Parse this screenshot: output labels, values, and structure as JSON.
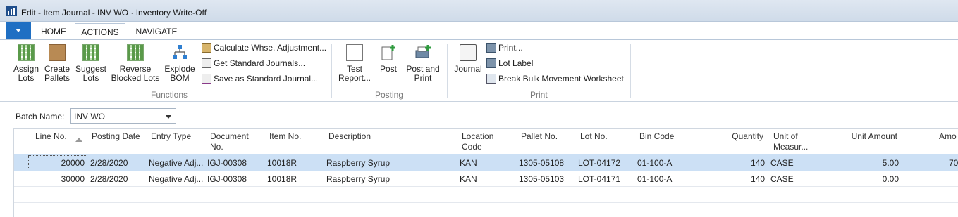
{
  "window": {
    "title": "Edit - Item Journal - INV WO · Inventory Write-Off"
  },
  "tabs": [
    {
      "label": "HOME"
    },
    {
      "label": "ACTIONS"
    },
    {
      "label": "NAVIGATE"
    }
  ],
  "ribbon": {
    "functions": {
      "label": "Functions",
      "assign_lots": [
        "Assign",
        "Lots"
      ],
      "create_pallets": [
        "Create",
        "Pallets"
      ],
      "suggest_lots": [
        "Suggest",
        "Lots"
      ],
      "reverse_blocked": [
        "Reverse",
        "Blocked Lots"
      ],
      "explode_bom": [
        "Explode",
        "BOM"
      ],
      "calc_whse": "Calculate Whse. Adjustment...",
      "get_std": "Get Standard Journals...",
      "save_std": "Save as Standard Journal..."
    },
    "posting": {
      "label": "Posting",
      "test_report": [
        "Test",
        "Report..."
      ],
      "post": "Post",
      "post_print": [
        "Post and",
        "Print"
      ]
    },
    "print": {
      "label": "Print",
      "journal": "Journal",
      "print": "Print...",
      "lot_label": "Lot Label",
      "break_bulk": "Break Bulk Movement Worksheet"
    }
  },
  "filter": {
    "batch_label": "Batch Name:",
    "batch_value": "INV WO"
  },
  "table": {
    "headers": {
      "line_no": "Line No.",
      "posting_date": "Posting Date",
      "entry_type": "Entry Type",
      "document_no": [
        "Document",
        "No."
      ],
      "item_no": "Item No.",
      "description": "Description",
      "location_code": [
        "Location",
        "Code"
      ],
      "pallet_no": "Pallet No.",
      "lot_no": "Lot No.",
      "bin_code": "Bin Code",
      "quantity": "Quantity",
      "uom": [
        "Unit of",
        "Measur..."
      ],
      "unit_amount": "Unit Amount",
      "amount": "Amo"
    },
    "rows": [
      {
        "line_no": "20000",
        "posting_date": "2/28/2020",
        "entry_type": "Negative Adj...",
        "document_no": "IGJ-00308",
        "item_no": "10018R",
        "description": "Raspberry Syrup",
        "location_code": "KAN",
        "pallet_no": "1305-05108",
        "lot_no": "LOT-04172",
        "bin_code": "01-100-A",
        "quantity": "140",
        "uom": "CASE",
        "unit_amount": "5.00",
        "amount": "70"
      },
      {
        "line_no": "30000",
        "posting_date": "2/28/2020",
        "entry_type": "Negative Adj...",
        "document_no": "IGJ-00308",
        "item_no": "10018R",
        "description": "Raspberry Syrup",
        "location_code": "KAN",
        "pallet_no": "1305-05103",
        "lot_no": "LOT-04171",
        "bin_code": "01-100-A",
        "quantity": "140",
        "uom": "CASE",
        "unit_amount": "0.00",
        "amount": ""
      }
    ]
  },
  "colors": {
    "accent": "#1f6fc3",
    "selected_row": "#cce0f5"
  }
}
